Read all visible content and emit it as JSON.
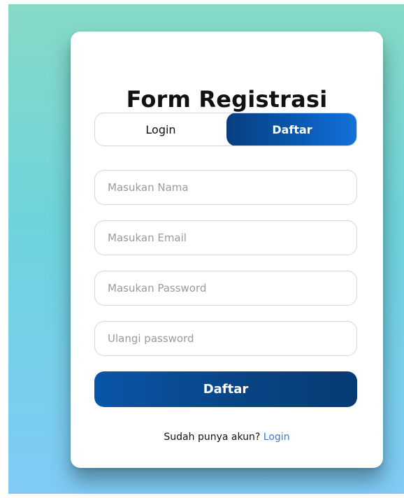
{
  "form": {
    "title": "Form Registrasi",
    "tabs": {
      "login_label": "Login",
      "register_label": "Daftar",
      "active": "Daftar"
    },
    "fields": {
      "name_placeholder": "Masukan Nama",
      "email_placeholder": "Masukan Email",
      "password_placeholder": "Masukan Password",
      "confirm_placeholder": "Ulangi password"
    },
    "submit_label": "Daftar",
    "footer": {
      "prompt": "Sudah punya akun?",
      "link_label": "Login"
    }
  },
  "colors": {
    "background_top": "#86dac6",
    "background_bottom": "#7fcbf6",
    "accent_dark": "#073f7f",
    "accent_light": "#1373dc",
    "link": "#3c7ccb"
  }
}
